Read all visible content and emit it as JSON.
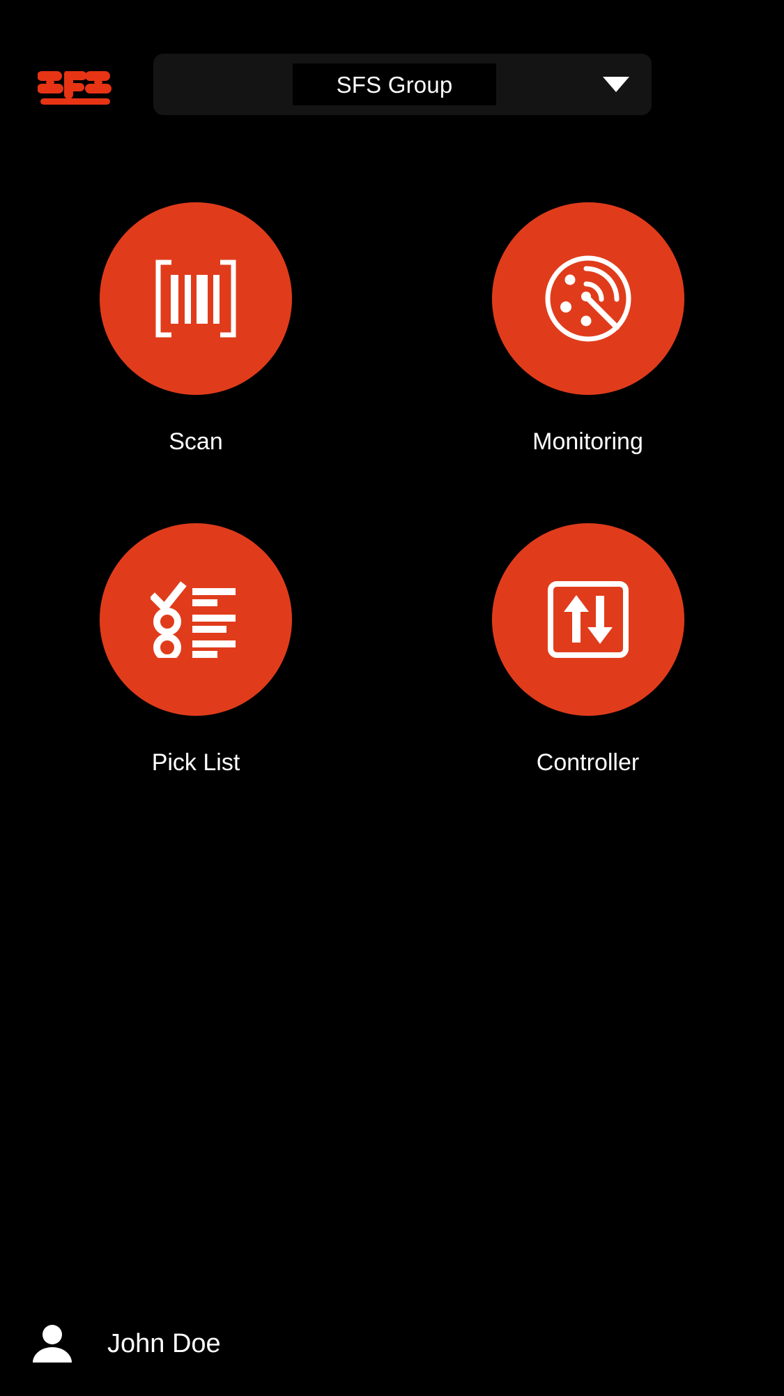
{
  "app": {
    "background_color": "#000000",
    "accent_color": "#e03c1c",
    "text_color": "#ffffff"
  },
  "header": {
    "logo_text": "SFS",
    "logo_name": "sfs-logo",
    "group_selector": {
      "value": "SFS Group",
      "caret_icon": "chevron-down-icon"
    }
  },
  "tiles": [
    {
      "label": "Scan",
      "icon": "barcode-scan-icon"
    },
    {
      "label": "Monitoring",
      "icon": "radar-monitoring-icon"
    },
    {
      "label": "Pick List",
      "icon": "checklist-icon"
    },
    {
      "label": "Controller",
      "icon": "up-down-arrows-icon"
    }
  ],
  "footer": {
    "avatar_icon": "person-icon",
    "user_name": "John Doe"
  }
}
